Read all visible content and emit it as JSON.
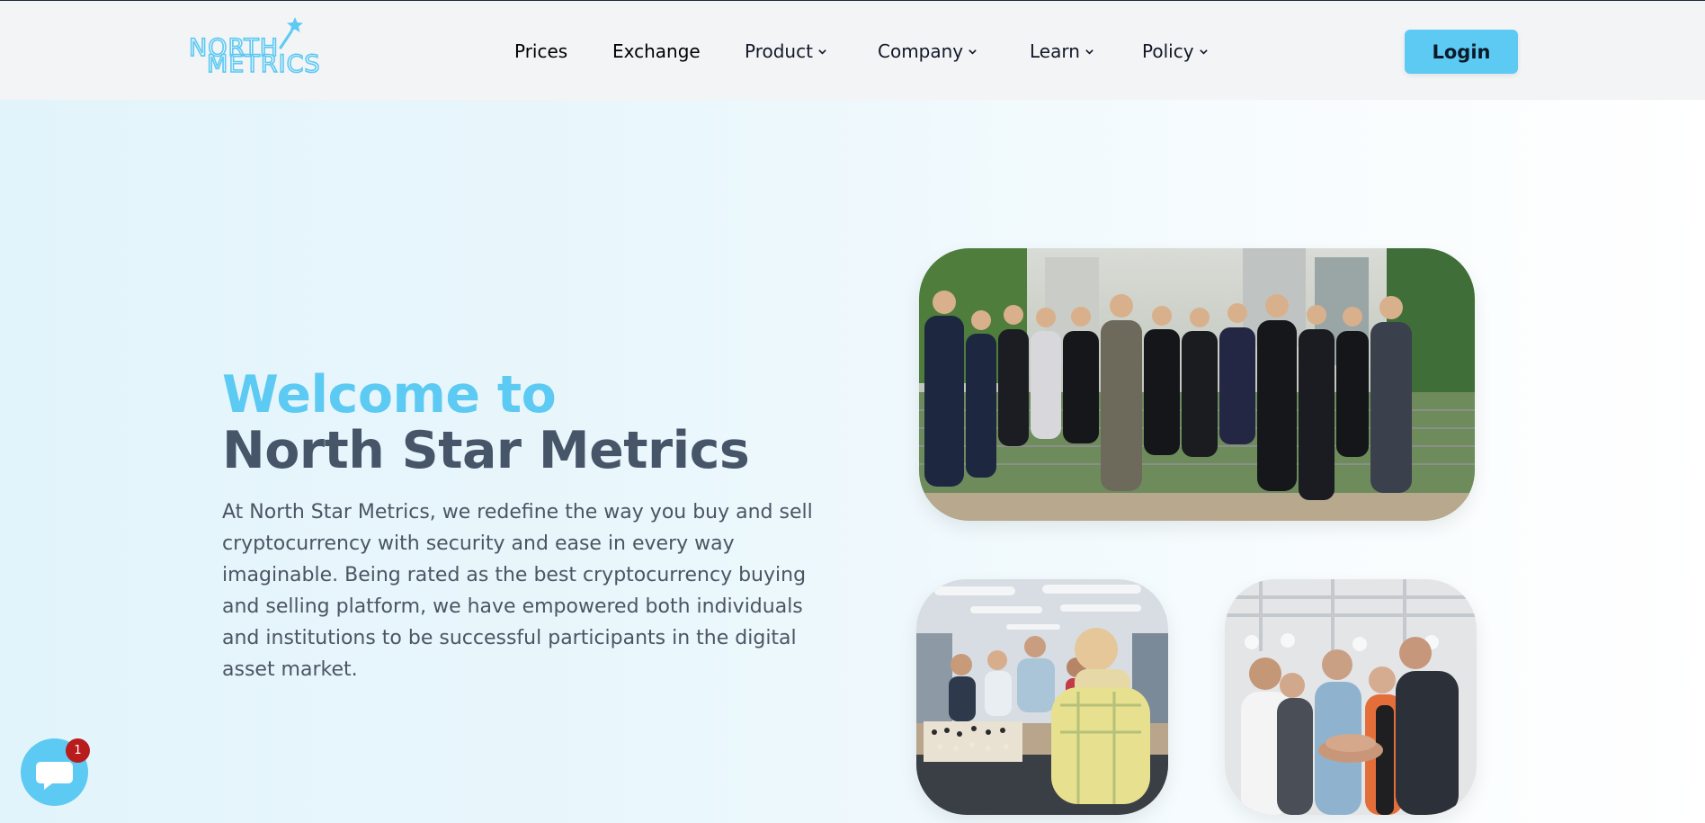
{
  "header": {
    "logo": {
      "line1": "NORTH",
      "line2": "METRICS",
      "icon": "star-icon",
      "color": "#5ccaf2"
    },
    "nav": [
      {
        "label": "Prices",
        "dropdown": false
      },
      {
        "label": "Exchange",
        "dropdown": false
      },
      {
        "label": "Product",
        "dropdown": true
      },
      {
        "label": "Company",
        "dropdown": true
      },
      {
        "label": "Learn",
        "dropdown": true
      },
      {
        "label": "Policy",
        "dropdown": true
      }
    ],
    "login_label": "Login"
  },
  "hero": {
    "welcome": "Welcome to",
    "brand": "North Star Metrics",
    "description": "At North Star Metrics, we redefine the way you buy and sell cryptocurrency with security and ease in every way imaginable. Being rated as the best cryptocurrency buying and selling platform, we have empowered both individuals and institutions to be successful participants in the digital asset market.",
    "images": [
      {
        "subject": "team-lineup-photo"
      },
      {
        "subject": "office-chess-photo"
      },
      {
        "subject": "team-hands-photo"
      }
    ]
  },
  "chat": {
    "icon": "chat-bubble-icon",
    "badge_count": "1"
  },
  "colors": {
    "accent": "#5ccaf2",
    "heading_dark": "#475569",
    "body_text": "#4b5563",
    "header_bg": "#f3f4f6",
    "badge": "#b91c1c"
  }
}
